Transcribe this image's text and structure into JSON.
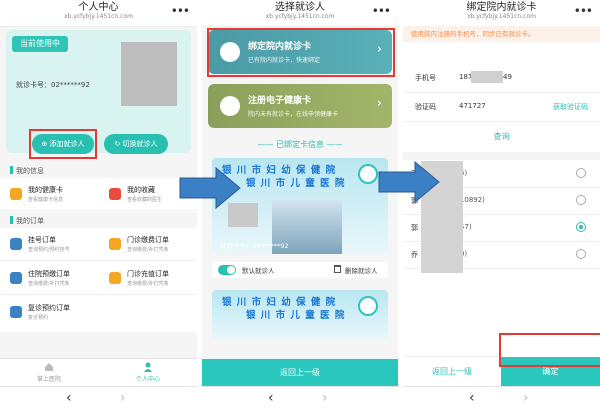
{
  "panel1": {
    "title": "个人中心",
    "url": "xb.ycfybjy.1451cn.com",
    "more": "•••",
    "current_badge": "当前使用中",
    "card_no": "就诊卡号：02******92",
    "add_button": "⊕ 添加就诊人",
    "switch_button": "↻ 切换就诊人",
    "section_info": "我的信息",
    "info_items": [
      {
        "name": "我的健康卡",
        "sub": "查看健康卡信息"
      },
      {
        "name": "我的收藏",
        "sub": "查看收藏的医生"
      }
    ],
    "section_orders": "我的订单",
    "order_items": [
      {
        "name": "挂号订单",
        "sub": "查询预约/预约挂号"
      },
      {
        "name": "门诊缴费订单",
        "sub": "查询缴费/补打凭条"
      },
      {
        "name": "住院预缴订单",
        "sub": "查询缴费/补打凭条"
      },
      {
        "name": "门诊充值订单",
        "sub": "查询缴费/补打凭条"
      },
      {
        "name": "复诊预约订单",
        "sub": "复诊预约"
      }
    ],
    "tabs": [
      {
        "label": "掌上医院"
      },
      {
        "label": "个人中心"
      }
    ]
  },
  "panel2": {
    "title": "选择就诊人",
    "url": "xb.ycfybjy.1451cn.com",
    "more": "•••",
    "bind_card": {
      "name": "绑定院内就诊卡",
      "sub": "已有院内就诊卡，快速绑定"
    },
    "register_card": {
      "name": "注册电子健康卡",
      "sub": "院内未有就诊卡，在线申领健康卡"
    },
    "bound_label": "—— 已绑定卡信息 ——",
    "hospital_line1": "银 川 市 妇 幼 保 健 院",
    "hospital_line2": "银 川 市 儿 童 医 院",
    "card_no": "就诊卡号：02******92",
    "default_label": "默认就诊人",
    "delete_label": "删除就诊人",
    "back_button": "返回上一级"
  },
  "panel3": {
    "title": "绑定院内就诊卡",
    "url": "xb.ycfybjy.1451cn.com",
    "more": "•••",
    "notice": "使用院内注册的手机号，同步已有就诊卡。",
    "phone_label": "手机号",
    "phone_prefix": "187",
    "phone_suffix": "49",
    "code_label": "验证码",
    "code_value": "471727",
    "get_code": "获取验证码",
    "query": "查询",
    "patients": [
      {
        "name": "郭",
        "id": "086)",
        "selected": false
      },
      {
        "name": "郭",
        "id": "1710892)",
        "selected": false
      },
      {
        "name": "郭",
        "id": "4047)",
        "selected": true
      },
      {
        "name": "乔",
        "id": "630)",
        "selected": false
      }
    ],
    "back_button": "返回上一级",
    "confirm_button": "确定"
  },
  "nav": {
    "back": "‹",
    "forward": "›"
  },
  "colors": {
    "accent": "#29bfb1",
    "highlight": "#e53935",
    "arrow": "#3b7fc4"
  }
}
